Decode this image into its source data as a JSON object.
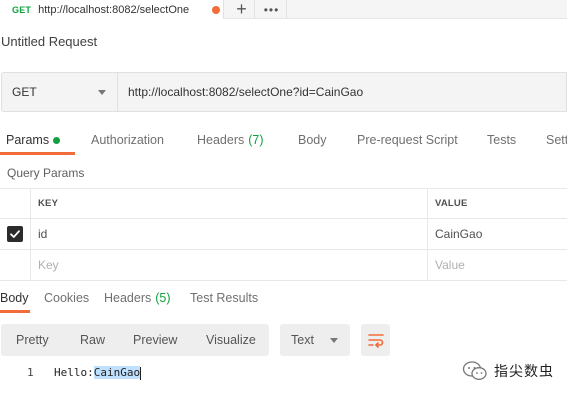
{
  "top_tab": {
    "method": "GET",
    "url": "http://localhost:8082/selectOne",
    "plus": "+",
    "more": "•••"
  },
  "request": {
    "title": "Untitled Request",
    "method": "GET",
    "url": "http://localhost:8082/selectOne?id=CainGao"
  },
  "request_tabs": [
    {
      "label": "Params"
    },
    {
      "label": "Authorization"
    },
    {
      "label": "Headers",
      "count": "(7)"
    },
    {
      "label": "Body"
    },
    {
      "label": "Pre-request Script"
    },
    {
      "label": "Tests"
    },
    {
      "label": "Settings"
    }
  ],
  "query_params": {
    "label": "Query Params",
    "headers": {
      "key": "KEY",
      "value": "VALUE"
    },
    "rows": [
      {
        "checked": true,
        "key": "id",
        "value": "CainGao"
      }
    ],
    "placeholder": {
      "key": "Key",
      "value": "Value"
    }
  },
  "response_tabs": [
    {
      "label": "Body"
    },
    {
      "label": "Cookies"
    },
    {
      "label": "Headers",
      "count": "(5)"
    },
    {
      "label": "Test Results"
    }
  ],
  "body_toolbar": {
    "views": [
      "Pretty",
      "Raw",
      "Preview",
      "Visualize"
    ],
    "format": "Text"
  },
  "response_body": {
    "line_number": "1",
    "prefix": "Hello:",
    "highlighted": "CainGao"
  },
  "watermark": {
    "text": "指尖数虫"
  },
  "colors": {
    "accent": "#f26b3a",
    "success": "#10a040"
  }
}
